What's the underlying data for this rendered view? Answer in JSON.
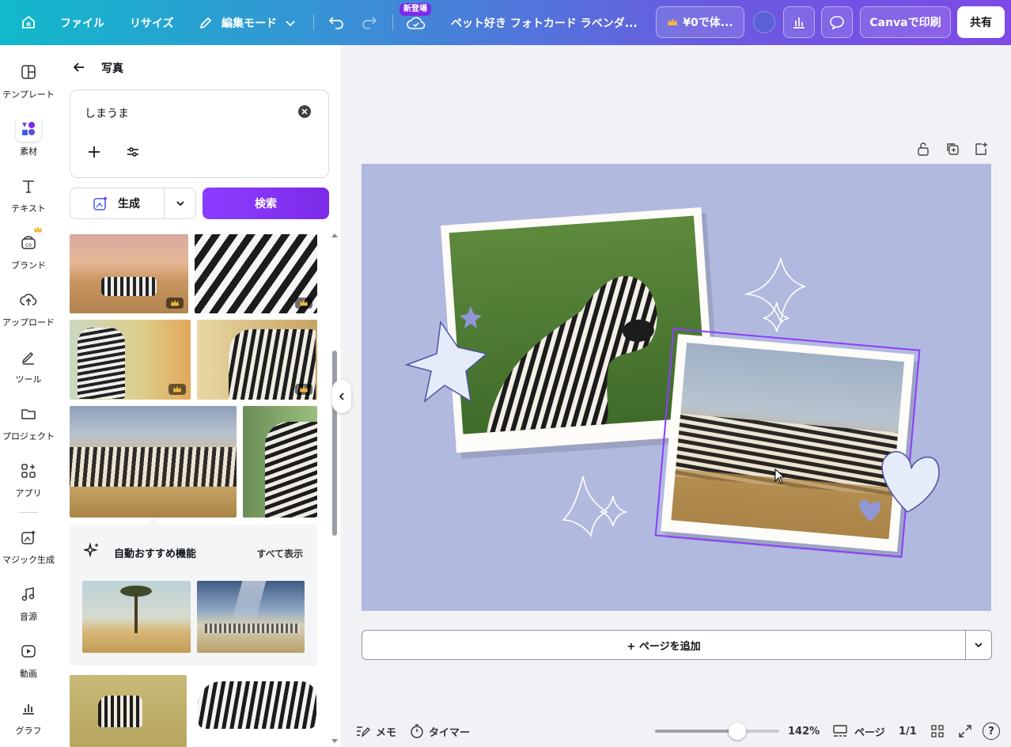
{
  "topbar": {
    "home_icon": "home-icon",
    "file_label": "ファイル",
    "resize_label": "リサイズ",
    "edit_mode_label": "編集モード",
    "new_badge": "新登場",
    "doc_title": "ペット好き フォトカード ラベンダ...",
    "trial_label": "¥0で体...",
    "print_label": "Canvaで印刷",
    "share_label": "共有",
    "accent_color": "#7d2ae8"
  },
  "rail": {
    "items": [
      {
        "label": "テンプレート",
        "icon": "template-icon"
      },
      {
        "label": "素材",
        "icon": "elements-icon"
      },
      {
        "label": "テキスト",
        "icon": "text-icon"
      },
      {
        "label": "ブランド",
        "icon": "brand-icon"
      },
      {
        "label": "アップロード",
        "icon": "upload-icon"
      },
      {
        "label": "ツール",
        "icon": "tools-icon"
      },
      {
        "label": "プロジェクト",
        "icon": "folder-icon"
      },
      {
        "label": "アプリ",
        "icon": "apps-icon"
      },
      {
        "label": "マジック生成",
        "icon": "magic-icon"
      },
      {
        "label": "音源",
        "icon": "music-icon"
      },
      {
        "label": "動画",
        "icon": "video-icon"
      },
      {
        "label": "グラフ",
        "icon": "chart-icon"
      }
    ]
  },
  "panel": {
    "title": "写真",
    "search_value": "しまうま",
    "generate_label": "生成",
    "search_button": "検索",
    "suggest_title": "自動おすすめ機能",
    "show_all": "すべて表示"
  },
  "canvas": {
    "page_bg": "#b2b9df",
    "add_page": "+ ページを追加"
  },
  "bottombar": {
    "notes": "メモ",
    "timer": "タイマー",
    "zoom": "142%",
    "zoom_level": 0.66,
    "pages_label": "ページ",
    "page_count": "1/1"
  }
}
